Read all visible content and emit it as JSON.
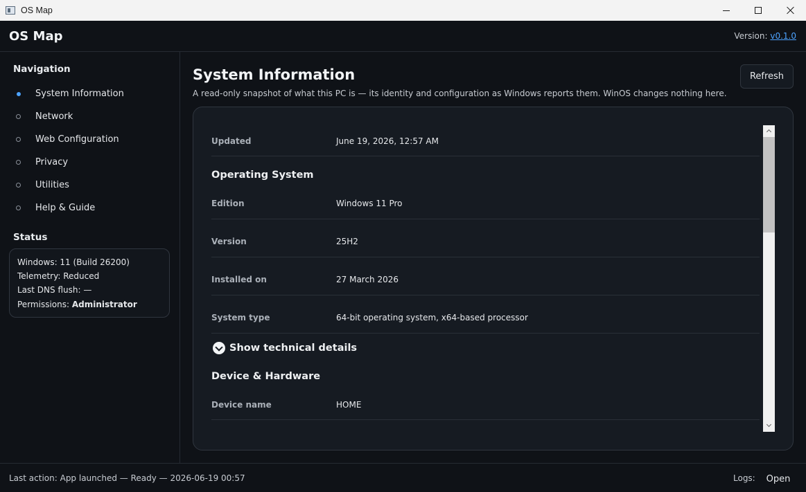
{
  "window": {
    "title": "OS Map",
    "icon": "app-window-icon"
  },
  "header": {
    "title": "OS Map",
    "version_label": "Version:",
    "version_link": "v0.1.0"
  },
  "sidebar": {
    "nav_heading": "Navigation",
    "items": [
      {
        "label": "System Information",
        "active": true
      },
      {
        "label": "Network",
        "active": false
      },
      {
        "label": "Web Configuration",
        "active": false
      },
      {
        "label": "Privacy",
        "active": false
      },
      {
        "label": "Utilities",
        "active": false
      },
      {
        "label": "Help & Guide",
        "active": false
      }
    ],
    "status_heading": "Status",
    "status": {
      "windows": "Windows: 11 (Build 26200)",
      "telemetry": "Telemetry: Reduced",
      "dns": "Last DNS flush: —",
      "permissions_label": "Permissions:",
      "permissions_value": "Administrator"
    }
  },
  "main": {
    "title": "System Information",
    "subtitle": "A read-only snapshot of what this PC is — its identity and configuration as Windows reports them. WinOS changes nothing here.",
    "refresh_label": "Refresh",
    "updated": {
      "label": "Updated",
      "value": "June 19, 2026, 12:57 AM"
    },
    "os_section": "Operating System",
    "os_rows": [
      {
        "label": "Edition",
        "value": "Windows 11 Pro"
      },
      {
        "label": "Version",
        "value": "25H2"
      },
      {
        "label": "Installed on",
        "value": "27 March 2026"
      },
      {
        "label": "System type",
        "value": "64-bit operating system, x64-based processor"
      }
    ],
    "toggle_label": "Show technical details",
    "device_section": "Device & Hardware",
    "device_rows": [
      {
        "label": "Device name",
        "value": "HOME"
      }
    ]
  },
  "footer": {
    "last_action": "Last action: App launched — Ready — 2026-06-19 00:57",
    "logs_label": "Logs:",
    "open_label": "Open"
  },
  "colors": {
    "accent": "#4da3ff",
    "background": "#0f1217",
    "panel": "#161b22"
  }
}
